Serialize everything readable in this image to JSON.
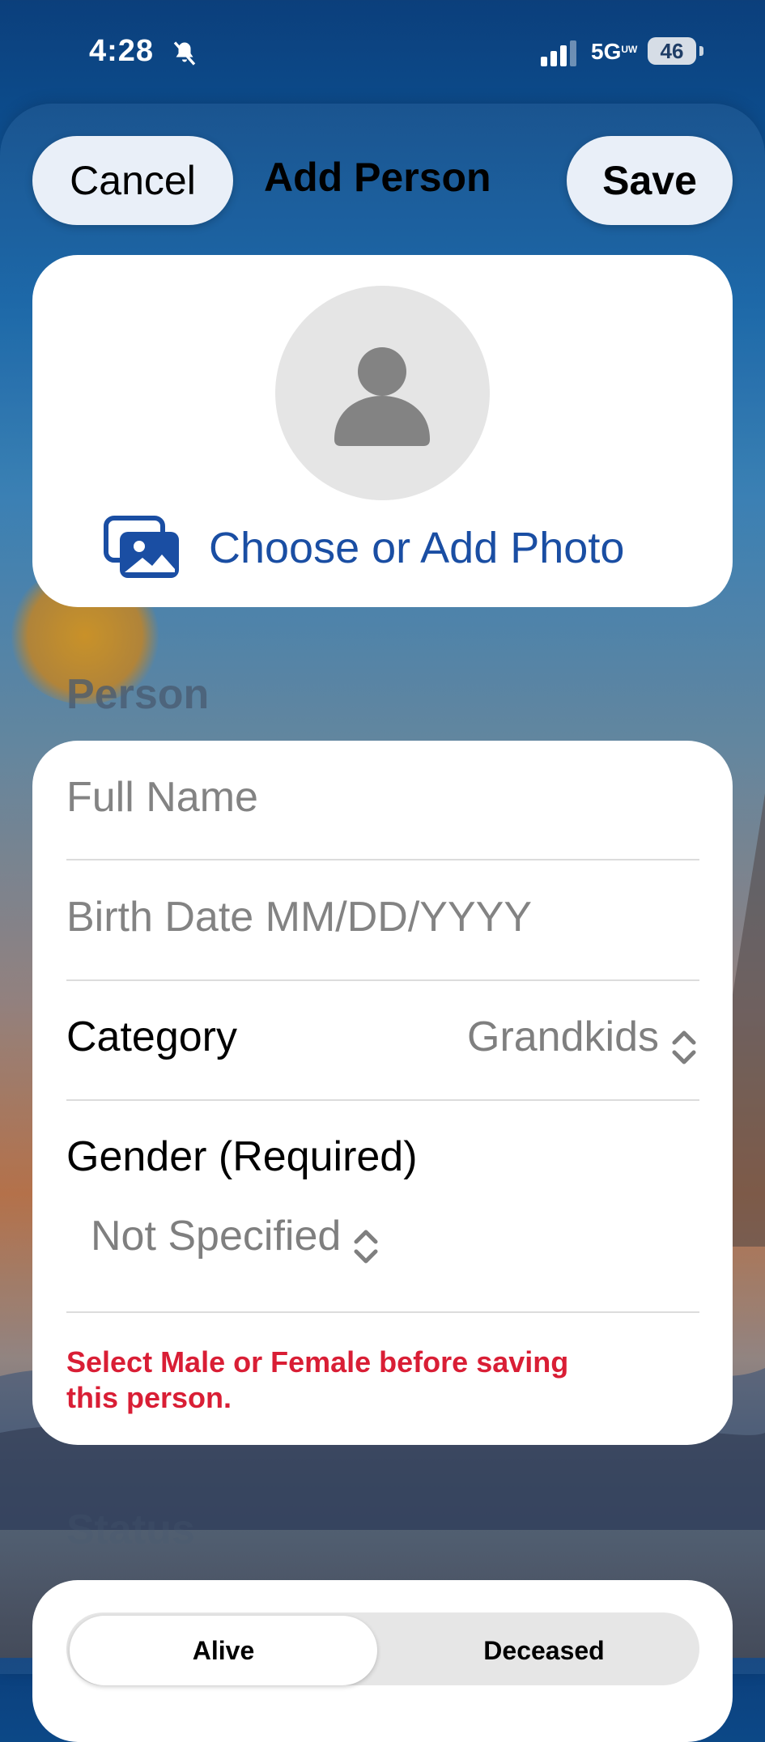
{
  "status_bar": {
    "time": "4:28",
    "network": "5G",
    "network_sup": "UW",
    "battery": "46"
  },
  "nav": {
    "cancel_label": "Cancel",
    "title": "Add Person",
    "save_label": "Save"
  },
  "photo": {
    "link_label": "Choose or Add Photo"
  },
  "sections": {
    "person": "Person",
    "status": "Status"
  },
  "form": {
    "full_name_placeholder": "Full Name",
    "birth_date_placeholder": "Birth Date MM/DD/YYYY",
    "category_label": "Category",
    "category_value": "Grandkids",
    "gender_label": "Gender (Required)",
    "gender_value": "Not Specified",
    "error_line1": "Select Male or Female before saving",
    "error_line2": "this person."
  },
  "status_segment": {
    "options": [
      "Alive",
      "Deceased"
    ],
    "selected": "Alive"
  },
  "colors": {
    "accent": "#1a4ea3",
    "error": "#d91e35",
    "card": "#ffffff"
  }
}
